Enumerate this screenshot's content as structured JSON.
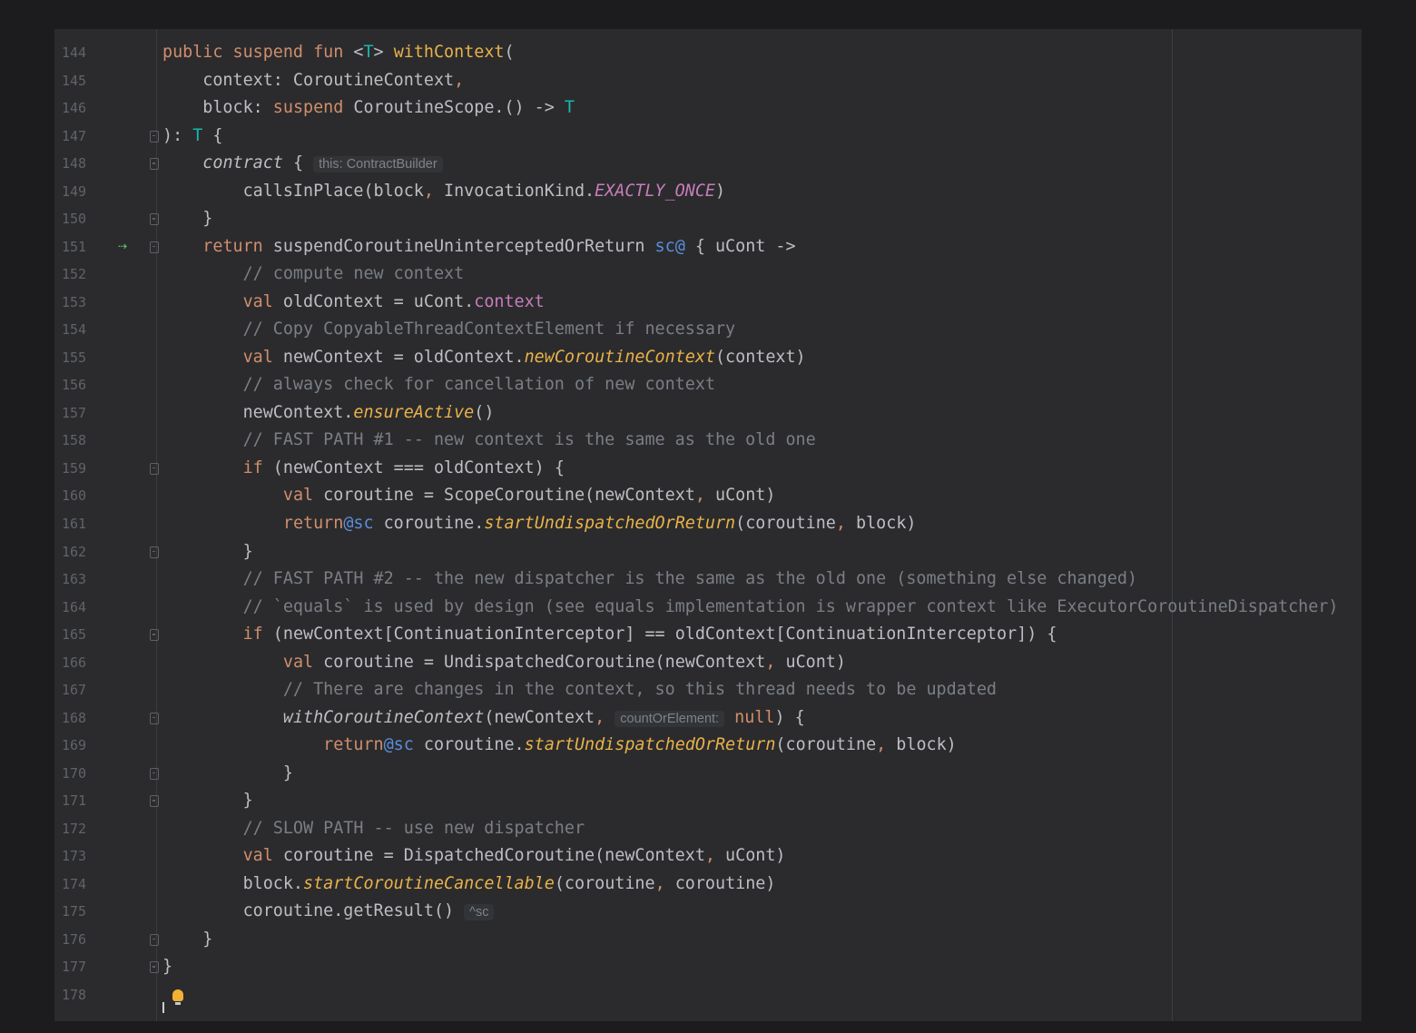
{
  "editor": {
    "lines": [
      {
        "n": "144",
        "seg": [
          [
            "k",
            "public suspend fun "
          ],
          [
            "t",
            "<"
          ],
          [
            "tp",
            "T"
          ],
          [
            "t",
            "> "
          ],
          [
            "d",
            "withContext"
          ],
          [
            "t",
            "("
          ]
        ]
      },
      {
        "n": "145",
        "seg": [
          [
            "t",
            "    context: CoroutineContext"
          ],
          [
            "pu",
            ","
          ]
        ]
      },
      {
        "n": "146",
        "seg": [
          [
            "t",
            "    block: "
          ],
          [
            "k",
            "suspend"
          ],
          [
            "t",
            " CoroutineScope.() -> "
          ],
          [
            "tp",
            "T"
          ]
        ]
      },
      {
        "n": "147",
        "fold": true,
        "seg": [
          [
            "t",
            "): "
          ],
          [
            "tp",
            "T"
          ],
          [
            "t",
            " {"
          ]
        ]
      },
      {
        "n": "148",
        "fold": true,
        "seg": [
          [
            "t",
            "    "
          ],
          [
            "fi",
            "contract"
          ],
          [
            "t",
            " { "
          ],
          [
            "h",
            "this: ContractBuilder"
          ]
        ]
      },
      {
        "n": "149",
        "seg": [
          [
            "t",
            "        callsInPlace(block"
          ],
          [
            "pu",
            ","
          ],
          [
            "t",
            " InvocationKind."
          ],
          [
            "pi",
            "EXACTLY_ONCE"
          ],
          [
            "t",
            ")"
          ]
        ]
      },
      {
        "n": "150",
        "fold": true,
        "seg": [
          [
            "t",
            "    }"
          ]
        ]
      },
      {
        "n": "151",
        "fold": true,
        "run": true,
        "seg": [
          [
            "t",
            "    "
          ],
          [
            "k",
            "return"
          ],
          [
            "t",
            " suspendCoroutineUninterceptedOrReturn "
          ],
          [
            "l",
            "sc@"
          ],
          [
            "t",
            " { uCont ->"
          ]
        ]
      },
      {
        "n": "152",
        "seg": [
          [
            "c",
            "        // compute new context"
          ]
        ]
      },
      {
        "n": "153",
        "seg": [
          [
            "t",
            "        "
          ],
          [
            "k",
            "val"
          ],
          [
            "t",
            " oldContext = uCont."
          ],
          [
            "p",
            "context"
          ]
        ]
      },
      {
        "n": "154",
        "seg": [
          [
            "c",
            "        // Copy CopyableThreadContextElement if necessary"
          ]
        ]
      },
      {
        "n": "155",
        "seg": [
          [
            "t",
            "        "
          ],
          [
            "k",
            "val"
          ],
          [
            "t",
            " newContext = oldContext."
          ],
          [
            "f",
            "newCoroutineContext"
          ],
          [
            "t",
            "(context)"
          ]
        ]
      },
      {
        "n": "156",
        "seg": [
          [
            "c",
            "        // always check for cancellation of new context"
          ]
        ]
      },
      {
        "n": "157",
        "seg": [
          [
            "t",
            "        newContext."
          ],
          [
            "f",
            "ensureActive"
          ],
          [
            "t",
            "()"
          ]
        ]
      },
      {
        "n": "158",
        "seg": [
          [
            "c",
            "        // FAST PATH #1 -- new context is the same as the old one"
          ]
        ]
      },
      {
        "n": "159",
        "fold": true,
        "seg": [
          [
            "t",
            "        "
          ],
          [
            "k",
            "if"
          ],
          [
            "t",
            " (newContext === oldContext) {"
          ]
        ]
      },
      {
        "n": "160",
        "seg": [
          [
            "t",
            "            "
          ],
          [
            "k",
            "val"
          ],
          [
            "t",
            " coroutine = ScopeCoroutine(newContext"
          ],
          [
            "pu",
            ","
          ],
          [
            "t",
            " uCont)"
          ]
        ]
      },
      {
        "n": "161",
        "seg": [
          [
            "t",
            "            "
          ],
          [
            "k",
            "return"
          ],
          [
            "l",
            "@sc"
          ],
          [
            "t",
            " coroutine."
          ],
          [
            "f",
            "startUndispatchedOrReturn"
          ],
          [
            "t",
            "(coroutine"
          ],
          [
            "pu",
            ","
          ],
          [
            "t",
            " block)"
          ]
        ]
      },
      {
        "n": "162",
        "fold": true,
        "seg": [
          [
            "t",
            "        }"
          ]
        ]
      },
      {
        "n": "163",
        "seg": [
          [
            "c",
            "        // FAST PATH #2 -- the new dispatcher is the same as the old one (something else changed)"
          ]
        ]
      },
      {
        "n": "164",
        "seg": [
          [
            "c",
            "        // `equals` is used by design (see equals implementation is wrapper context like ExecutorCoroutineDispatcher)"
          ]
        ]
      },
      {
        "n": "165",
        "fold": true,
        "seg": [
          [
            "t",
            "        "
          ],
          [
            "k",
            "if"
          ],
          [
            "t",
            " (newContext[ContinuationInterceptor] == oldContext[ContinuationInterceptor]) {"
          ]
        ]
      },
      {
        "n": "166",
        "seg": [
          [
            "t",
            "            "
          ],
          [
            "k",
            "val"
          ],
          [
            "t",
            " coroutine = UndispatchedCoroutine(newContext"
          ],
          [
            "pu",
            ","
          ],
          [
            "t",
            " uCont)"
          ]
        ]
      },
      {
        "n": "167",
        "seg": [
          [
            "c",
            "            // There are changes in the context, so this thread needs to be updated"
          ]
        ]
      },
      {
        "n": "168",
        "fold": true,
        "seg": [
          [
            "t",
            "            "
          ],
          [
            "fi",
            "withCoroutineContext"
          ],
          [
            "t",
            "(newContext"
          ],
          [
            "pu",
            ","
          ],
          [
            "t",
            " "
          ],
          [
            "h",
            "countOrElement:"
          ],
          [
            "t",
            " "
          ],
          [
            "k",
            "null"
          ],
          [
            "t",
            ") {"
          ]
        ]
      },
      {
        "n": "169",
        "seg": [
          [
            "t",
            "                "
          ],
          [
            "k",
            "return"
          ],
          [
            "l",
            "@sc"
          ],
          [
            "t",
            " coroutine."
          ],
          [
            "f",
            "startUndispatchedOrReturn"
          ],
          [
            "t",
            "(coroutine"
          ],
          [
            "pu",
            ","
          ],
          [
            "t",
            " block)"
          ]
        ]
      },
      {
        "n": "170",
        "fold": true,
        "seg": [
          [
            "t",
            "            }"
          ]
        ]
      },
      {
        "n": "171",
        "fold": true,
        "seg": [
          [
            "t",
            "        }"
          ]
        ]
      },
      {
        "n": "172",
        "seg": [
          [
            "c",
            "        // SLOW PATH -- use new dispatcher"
          ]
        ]
      },
      {
        "n": "173",
        "seg": [
          [
            "t",
            "        "
          ],
          [
            "k",
            "val"
          ],
          [
            "t",
            " coroutine = DispatchedCoroutine(newContext"
          ],
          [
            "pu",
            ","
          ],
          [
            "t",
            " uCont)"
          ]
        ]
      },
      {
        "n": "174",
        "seg": [
          [
            "t",
            "        block."
          ],
          [
            "f",
            "startCoroutineCancellable"
          ],
          [
            "t",
            "(coroutine"
          ],
          [
            "pu",
            ","
          ],
          [
            "t",
            " coroutine)"
          ]
        ]
      },
      {
        "n": "175",
        "seg": [
          [
            "t",
            "        coroutine.getResult() "
          ],
          [
            "h",
            "^sc"
          ]
        ]
      },
      {
        "n": "176",
        "fold": true,
        "seg": [
          [
            "t",
            "    }"
          ]
        ]
      },
      {
        "n": "177",
        "fold": true,
        "seg": [
          [
            "t",
            "}"
          ]
        ]
      },
      {
        "n": "178",
        "bulb": true,
        "seg": []
      }
    ]
  }
}
